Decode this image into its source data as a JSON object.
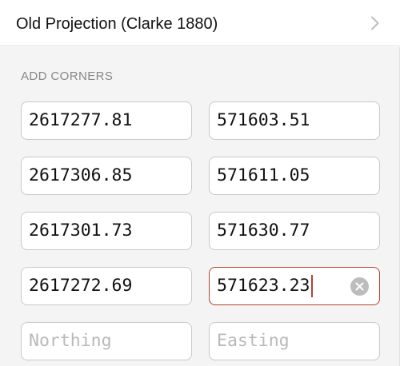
{
  "header": {
    "title": "Old Projection (Clarke 1880)",
    "chevron_icon": "chevron-right-icon"
  },
  "section": {
    "label": "ADD CORNERS"
  },
  "corners": [
    {
      "northing": "2617277.81",
      "easting": "571603.51"
    },
    {
      "northing": "2617306.85",
      "easting": "571611.05"
    },
    {
      "northing": "2617301.73",
      "easting": "571630.77"
    },
    {
      "northing": "2617272.69",
      "easting": "571623.23"
    }
  ],
  "new_corner": {
    "northing_placeholder": "Northing",
    "easting_placeholder": "Easting"
  },
  "colors": {
    "active_border": "#b7412f",
    "caret": "#b7412f",
    "clear_button": "#bdbdbd"
  },
  "active_field": "corners.3.easting",
  "clear_icon": "clear-circle-icon"
}
